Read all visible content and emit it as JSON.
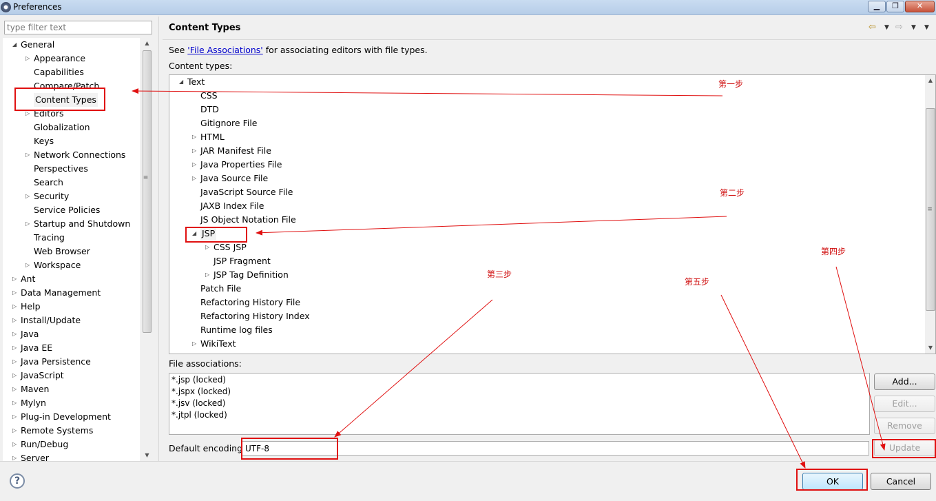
{
  "window": {
    "title": "Preferences",
    "controls": {
      "minimize": "▁",
      "maximize": "❐",
      "close": "✕"
    }
  },
  "left": {
    "filter_placeholder": "type filter text",
    "tree": [
      {
        "label": "General",
        "level": 0,
        "arrow": "expanded"
      },
      {
        "label": "Appearance",
        "level": 1,
        "arrow": "collapsed"
      },
      {
        "label": "Capabilities",
        "level": 1,
        "arrow": "none"
      },
      {
        "label": "Compare/Patch",
        "level": 1,
        "arrow": "none"
      },
      {
        "label": "Content Types",
        "level": 1,
        "arrow": "none",
        "selected": true
      },
      {
        "label": "Editors",
        "level": 1,
        "arrow": "collapsed"
      },
      {
        "label": "Globalization",
        "level": 1,
        "arrow": "none"
      },
      {
        "label": "Keys",
        "level": 1,
        "arrow": "none"
      },
      {
        "label": "Network Connections",
        "level": 1,
        "arrow": "collapsed"
      },
      {
        "label": "Perspectives",
        "level": 1,
        "arrow": "none"
      },
      {
        "label": "Search",
        "level": 1,
        "arrow": "none"
      },
      {
        "label": "Security",
        "level": 1,
        "arrow": "collapsed"
      },
      {
        "label": "Service Policies",
        "level": 1,
        "arrow": "none"
      },
      {
        "label": "Startup and Shutdown",
        "level": 1,
        "arrow": "collapsed"
      },
      {
        "label": "Tracing",
        "level": 1,
        "arrow": "none"
      },
      {
        "label": "Web Browser",
        "level": 1,
        "arrow": "none"
      },
      {
        "label": "Workspace",
        "level": 1,
        "arrow": "collapsed"
      },
      {
        "label": "Ant",
        "level": 0,
        "arrow": "collapsed"
      },
      {
        "label": "Data Management",
        "level": 0,
        "arrow": "collapsed"
      },
      {
        "label": "Help",
        "level": 0,
        "arrow": "collapsed"
      },
      {
        "label": "Install/Update",
        "level": 0,
        "arrow": "collapsed"
      },
      {
        "label": "Java",
        "level": 0,
        "arrow": "collapsed"
      },
      {
        "label": "Java EE",
        "level": 0,
        "arrow": "collapsed"
      },
      {
        "label": "Java Persistence",
        "level": 0,
        "arrow": "collapsed"
      },
      {
        "label": "JavaScript",
        "level": 0,
        "arrow": "collapsed"
      },
      {
        "label": "Maven",
        "level": 0,
        "arrow": "collapsed"
      },
      {
        "label": "Mylyn",
        "level": 0,
        "arrow": "collapsed"
      },
      {
        "label": "Plug-in Development",
        "level": 0,
        "arrow": "collapsed"
      },
      {
        "label": "Remote Systems",
        "level": 0,
        "arrow": "collapsed"
      },
      {
        "label": "Run/Debug",
        "level": 0,
        "arrow": "collapsed"
      },
      {
        "label": "Server",
        "level": 0,
        "arrow": "collapsed"
      }
    ]
  },
  "main": {
    "page_title": "Content Types",
    "see_prefix": "See ",
    "see_link": "'File Associations'",
    "see_suffix": " for associating editors with file types.",
    "content_types_label": "Content types:",
    "content_types": [
      {
        "label": "Text",
        "level": 0,
        "arrow": "expanded"
      },
      {
        "label": "CSS",
        "level": 1,
        "arrow": "none"
      },
      {
        "label": "DTD",
        "level": 1,
        "arrow": "none"
      },
      {
        "label": "Gitignore File",
        "level": 1,
        "arrow": "none"
      },
      {
        "label": "HTML",
        "level": 1,
        "arrow": "collapsed"
      },
      {
        "label": "JAR Manifest File",
        "level": 1,
        "arrow": "collapsed"
      },
      {
        "label": "Java Properties File",
        "level": 1,
        "arrow": "collapsed"
      },
      {
        "label": "Java Source File",
        "level": 1,
        "arrow": "collapsed"
      },
      {
        "label": "JavaScript Source File",
        "level": 1,
        "arrow": "none"
      },
      {
        "label": "JAXB Index File",
        "level": 1,
        "arrow": "none"
      },
      {
        "label": "JS Object Notation File",
        "level": 1,
        "arrow": "none"
      },
      {
        "label": "JSP",
        "level": 1,
        "arrow": "expanded",
        "selected": true
      },
      {
        "label": "CSS JSP",
        "level": 2,
        "arrow": "collapsed"
      },
      {
        "label": "JSP Fragment",
        "level": 2,
        "arrow": "none"
      },
      {
        "label": "JSP Tag Definition",
        "level": 2,
        "arrow": "collapsed"
      },
      {
        "label": "Patch File",
        "level": 1,
        "arrow": "none"
      },
      {
        "label": "Refactoring History File",
        "level": 1,
        "arrow": "none"
      },
      {
        "label": "Refactoring History Index",
        "level": 1,
        "arrow": "none"
      },
      {
        "label": "Runtime log files",
        "level": 1,
        "arrow": "none"
      },
      {
        "label": "WikiText",
        "level": 1,
        "arrow": "collapsed"
      }
    ],
    "file_associations_label": "File associations:",
    "file_associations": [
      "*.jsp (locked)",
      "*.jspx (locked)",
      "*.jsv (locked)",
      "*.jtpl (locked)"
    ],
    "buttons": {
      "add": "Add...",
      "edit": "Edit...",
      "remove": "Remove",
      "update": "Update"
    },
    "default_encoding_label": "Default encoding:",
    "default_encoding_value": "UTF-8"
  },
  "footer": {
    "help": "?",
    "ok": "OK",
    "cancel": "Cancel"
  },
  "annotations": {
    "step1": "第一步",
    "step2": "第二步",
    "step3": "第三步",
    "step4": "第四步",
    "step5": "第五步",
    "color": "#e01010"
  }
}
